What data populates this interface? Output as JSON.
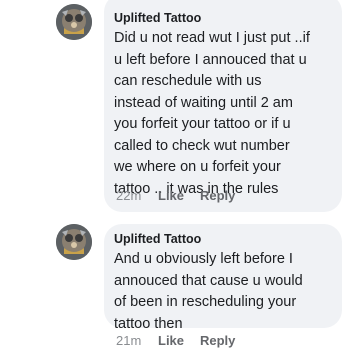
{
  "comments": [
    {
      "author": "Uplifted Tattoo",
      "text": "Did u not read wut I just put ..if\nu left before I annouced that u\ncan reschedule with us\ninstead of waiting until 2 am\nyou forfeit your tattoo or if u\ncalled to check wut number\nwe where on u forfeit your\ntattoo .. it was in the rules",
      "time": "22m",
      "like_label": "Like",
      "reply_label": "Reply"
    },
    {
      "author": "Uplifted Tattoo",
      "text": "And u obviously left before I\nannouced that cause u would\nof been in rescheduling your\ntattoo then",
      "time": "21m",
      "like_label": "Like",
      "reply_label": "Reply"
    }
  ],
  "colors": {
    "bubble": "#f0f2f5",
    "text": "#1c1e21",
    "meta": "#65676b"
  }
}
